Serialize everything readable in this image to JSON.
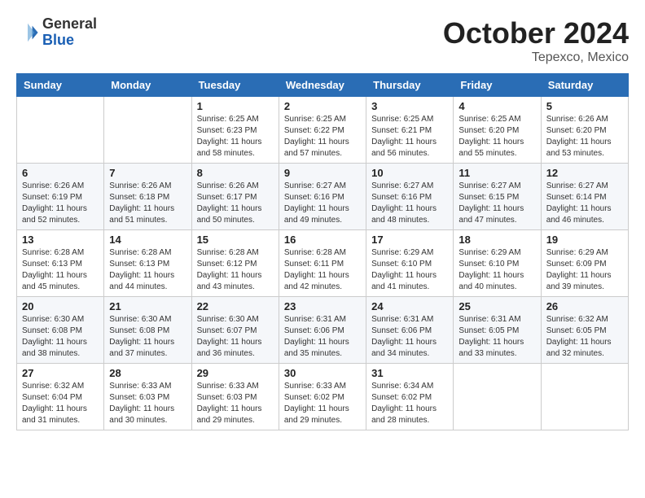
{
  "header": {
    "logo_general": "General",
    "logo_blue": "Blue",
    "month_title": "October 2024",
    "location": "Tepexco, Mexico"
  },
  "weekdays": [
    "Sunday",
    "Monday",
    "Tuesday",
    "Wednesday",
    "Thursday",
    "Friday",
    "Saturday"
  ],
  "weeks": [
    [
      {
        "day": "",
        "info": ""
      },
      {
        "day": "",
        "info": ""
      },
      {
        "day": "1",
        "info": "Sunrise: 6:25 AM\nSunset: 6:23 PM\nDaylight: 11 hours and 58 minutes."
      },
      {
        "day": "2",
        "info": "Sunrise: 6:25 AM\nSunset: 6:22 PM\nDaylight: 11 hours and 57 minutes."
      },
      {
        "day": "3",
        "info": "Sunrise: 6:25 AM\nSunset: 6:21 PM\nDaylight: 11 hours and 56 minutes."
      },
      {
        "day": "4",
        "info": "Sunrise: 6:25 AM\nSunset: 6:20 PM\nDaylight: 11 hours and 55 minutes."
      },
      {
        "day": "5",
        "info": "Sunrise: 6:26 AM\nSunset: 6:20 PM\nDaylight: 11 hours and 53 minutes."
      }
    ],
    [
      {
        "day": "6",
        "info": "Sunrise: 6:26 AM\nSunset: 6:19 PM\nDaylight: 11 hours and 52 minutes."
      },
      {
        "day": "7",
        "info": "Sunrise: 6:26 AM\nSunset: 6:18 PM\nDaylight: 11 hours and 51 minutes."
      },
      {
        "day": "8",
        "info": "Sunrise: 6:26 AM\nSunset: 6:17 PM\nDaylight: 11 hours and 50 minutes."
      },
      {
        "day": "9",
        "info": "Sunrise: 6:27 AM\nSunset: 6:16 PM\nDaylight: 11 hours and 49 minutes."
      },
      {
        "day": "10",
        "info": "Sunrise: 6:27 AM\nSunset: 6:16 PM\nDaylight: 11 hours and 48 minutes."
      },
      {
        "day": "11",
        "info": "Sunrise: 6:27 AM\nSunset: 6:15 PM\nDaylight: 11 hours and 47 minutes."
      },
      {
        "day": "12",
        "info": "Sunrise: 6:27 AM\nSunset: 6:14 PM\nDaylight: 11 hours and 46 minutes."
      }
    ],
    [
      {
        "day": "13",
        "info": "Sunrise: 6:28 AM\nSunset: 6:13 PM\nDaylight: 11 hours and 45 minutes."
      },
      {
        "day": "14",
        "info": "Sunrise: 6:28 AM\nSunset: 6:13 PM\nDaylight: 11 hours and 44 minutes."
      },
      {
        "day": "15",
        "info": "Sunrise: 6:28 AM\nSunset: 6:12 PM\nDaylight: 11 hours and 43 minutes."
      },
      {
        "day": "16",
        "info": "Sunrise: 6:28 AM\nSunset: 6:11 PM\nDaylight: 11 hours and 42 minutes."
      },
      {
        "day": "17",
        "info": "Sunrise: 6:29 AM\nSunset: 6:10 PM\nDaylight: 11 hours and 41 minutes."
      },
      {
        "day": "18",
        "info": "Sunrise: 6:29 AM\nSunset: 6:10 PM\nDaylight: 11 hours and 40 minutes."
      },
      {
        "day": "19",
        "info": "Sunrise: 6:29 AM\nSunset: 6:09 PM\nDaylight: 11 hours and 39 minutes."
      }
    ],
    [
      {
        "day": "20",
        "info": "Sunrise: 6:30 AM\nSunset: 6:08 PM\nDaylight: 11 hours and 38 minutes."
      },
      {
        "day": "21",
        "info": "Sunrise: 6:30 AM\nSunset: 6:08 PM\nDaylight: 11 hours and 37 minutes."
      },
      {
        "day": "22",
        "info": "Sunrise: 6:30 AM\nSunset: 6:07 PM\nDaylight: 11 hours and 36 minutes."
      },
      {
        "day": "23",
        "info": "Sunrise: 6:31 AM\nSunset: 6:06 PM\nDaylight: 11 hours and 35 minutes."
      },
      {
        "day": "24",
        "info": "Sunrise: 6:31 AM\nSunset: 6:06 PM\nDaylight: 11 hours and 34 minutes."
      },
      {
        "day": "25",
        "info": "Sunrise: 6:31 AM\nSunset: 6:05 PM\nDaylight: 11 hours and 33 minutes."
      },
      {
        "day": "26",
        "info": "Sunrise: 6:32 AM\nSunset: 6:05 PM\nDaylight: 11 hours and 32 minutes."
      }
    ],
    [
      {
        "day": "27",
        "info": "Sunrise: 6:32 AM\nSunset: 6:04 PM\nDaylight: 11 hours and 31 minutes."
      },
      {
        "day": "28",
        "info": "Sunrise: 6:33 AM\nSunset: 6:03 PM\nDaylight: 11 hours and 30 minutes."
      },
      {
        "day": "29",
        "info": "Sunrise: 6:33 AM\nSunset: 6:03 PM\nDaylight: 11 hours and 29 minutes."
      },
      {
        "day": "30",
        "info": "Sunrise: 6:33 AM\nSunset: 6:02 PM\nDaylight: 11 hours and 29 minutes."
      },
      {
        "day": "31",
        "info": "Sunrise: 6:34 AM\nSunset: 6:02 PM\nDaylight: 11 hours and 28 minutes."
      },
      {
        "day": "",
        "info": ""
      },
      {
        "day": "",
        "info": ""
      }
    ]
  ]
}
